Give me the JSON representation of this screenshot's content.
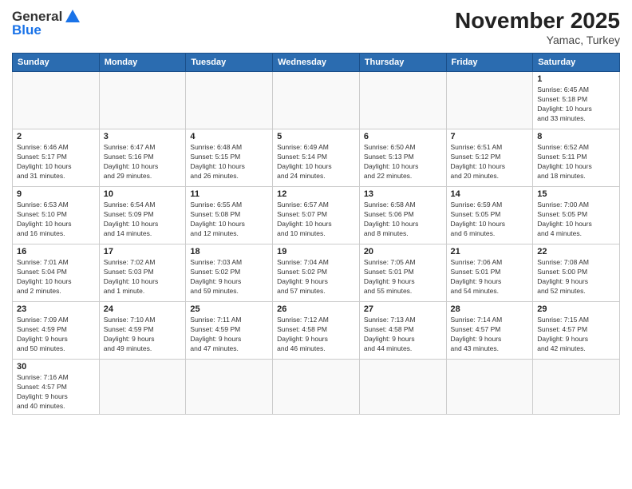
{
  "header": {
    "logo_general": "General",
    "logo_blue": "Blue",
    "month_year": "November 2025",
    "location": "Yamac, Turkey"
  },
  "weekdays": [
    "Sunday",
    "Monday",
    "Tuesday",
    "Wednesday",
    "Thursday",
    "Friday",
    "Saturday"
  ],
  "weeks": [
    [
      {
        "day": "",
        "info": ""
      },
      {
        "day": "",
        "info": ""
      },
      {
        "day": "",
        "info": ""
      },
      {
        "day": "",
        "info": ""
      },
      {
        "day": "",
        "info": ""
      },
      {
        "day": "",
        "info": ""
      },
      {
        "day": "1",
        "info": "Sunrise: 6:45 AM\nSunset: 5:18 PM\nDaylight: 10 hours\nand 33 minutes."
      }
    ],
    [
      {
        "day": "2",
        "info": "Sunrise: 6:46 AM\nSunset: 5:17 PM\nDaylight: 10 hours\nand 31 minutes."
      },
      {
        "day": "3",
        "info": "Sunrise: 6:47 AM\nSunset: 5:16 PM\nDaylight: 10 hours\nand 29 minutes."
      },
      {
        "day": "4",
        "info": "Sunrise: 6:48 AM\nSunset: 5:15 PM\nDaylight: 10 hours\nand 26 minutes."
      },
      {
        "day": "5",
        "info": "Sunrise: 6:49 AM\nSunset: 5:14 PM\nDaylight: 10 hours\nand 24 minutes."
      },
      {
        "day": "6",
        "info": "Sunrise: 6:50 AM\nSunset: 5:13 PM\nDaylight: 10 hours\nand 22 minutes."
      },
      {
        "day": "7",
        "info": "Sunrise: 6:51 AM\nSunset: 5:12 PM\nDaylight: 10 hours\nand 20 minutes."
      },
      {
        "day": "8",
        "info": "Sunrise: 6:52 AM\nSunset: 5:11 PM\nDaylight: 10 hours\nand 18 minutes."
      }
    ],
    [
      {
        "day": "9",
        "info": "Sunrise: 6:53 AM\nSunset: 5:10 PM\nDaylight: 10 hours\nand 16 minutes."
      },
      {
        "day": "10",
        "info": "Sunrise: 6:54 AM\nSunset: 5:09 PM\nDaylight: 10 hours\nand 14 minutes."
      },
      {
        "day": "11",
        "info": "Sunrise: 6:55 AM\nSunset: 5:08 PM\nDaylight: 10 hours\nand 12 minutes."
      },
      {
        "day": "12",
        "info": "Sunrise: 6:57 AM\nSunset: 5:07 PM\nDaylight: 10 hours\nand 10 minutes."
      },
      {
        "day": "13",
        "info": "Sunrise: 6:58 AM\nSunset: 5:06 PM\nDaylight: 10 hours\nand 8 minutes."
      },
      {
        "day": "14",
        "info": "Sunrise: 6:59 AM\nSunset: 5:05 PM\nDaylight: 10 hours\nand 6 minutes."
      },
      {
        "day": "15",
        "info": "Sunrise: 7:00 AM\nSunset: 5:05 PM\nDaylight: 10 hours\nand 4 minutes."
      }
    ],
    [
      {
        "day": "16",
        "info": "Sunrise: 7:01 AM\nSunset: 5:04 PM\nDaylight: 10 hours\nand 2 minutes."
      },
      {
        "day": "17",
        "info": "Sunrise: 7:02 AM\nSunset: 5:03 PM\nDaylight: 10 hours\nand 1 minute."
      },
      {
        "day": "18",
        "info": "Sunrise: 7:03 AM\nSunset: 5:02 PM\nDaylight: 9 hours\nand 59 minutes."
      },
      {
        "day": "19",
        "info": "Sunrise: 7:04 AM\nSunset: 5:02 PM\nDaylight: 9 hours\nand 57 minutes."
      },
      {
        "day": "20",
        "info": "Sunrise: 7:05 AM\nSunset: 5:01 PM\nDaylight: 9 hours\nand 55 minutes."
      },
      {
        "day": "21",
        "info": "Sunrise: 7:06 AM\nSunset: 5:01 PM\nDaylight: 9 hours\nand 54 minutes."
      },
      {
        "day": "22",
        "info": "Sunrise: 7:08 AM\nSunset: 5:00 PM\nDaylight: 9 hours\nand 52 minutes."
      }
    ],
    [
      {
        "day": "23",
        "info": "Sunrise: 7:09 AM\nSunset: 4:59 PM\nDaylight: 9 hours\nand 50 minutes."
      },
      {
        "day": "24",
        "info": "Sunrise: 7:10 AM\nSunset: 4:59 PM\nDaylight: 9 hours\nand 49 minutes."
      },
      {
        "day": "25",
        "info": "Sunrise: 7:11 AM\nSunset: 4:59 PM\nDaylight: 9 hours\nand 47 minutes."
      },
      {
        "day": "26",
        "info": "Sunrise: 7:12 AM\nSunset: 4:58 PM\nDaylight: 9 hours\nand 46 minutes."
      },
      {
        "day": "27",
        "info": "Sunrise: 7:13 AM\nSunset: 4:58 PM\nDaylight: 9 hours\nand 44 minutes."
      },
      {
        "day": "28",
        "info": "Sunrise: 7:14 AM\nSunset: 4:57 PM\nDaylight: 9 hours\nand 43 minutes."
      },
      {
        "day": "29",
        "info": "Sunrise: 7:15 AM\nSunset: 4:57 PM\nDaylight: 9 hours\nand 42 minutes."
      }
    ],
    [
      {
        "day": "30",
        "info": "Sunrise: 7:16 AM\nSunset: 4:57 PM\nDaylight: 9 hours\nand 40 minutes."
      },
      {
        "day": "",
        "info": ""
      },
      {
        "day": "",
        "info": ""
      },
      {
        "day": "",
        "info": ""
      },
      {
        "day": "",
        "info": ""
      },
      {
        "day": "",
        "info": ""
      },
      {
        "day": "",
        "info": ""
      }
    ]
  ]
}
